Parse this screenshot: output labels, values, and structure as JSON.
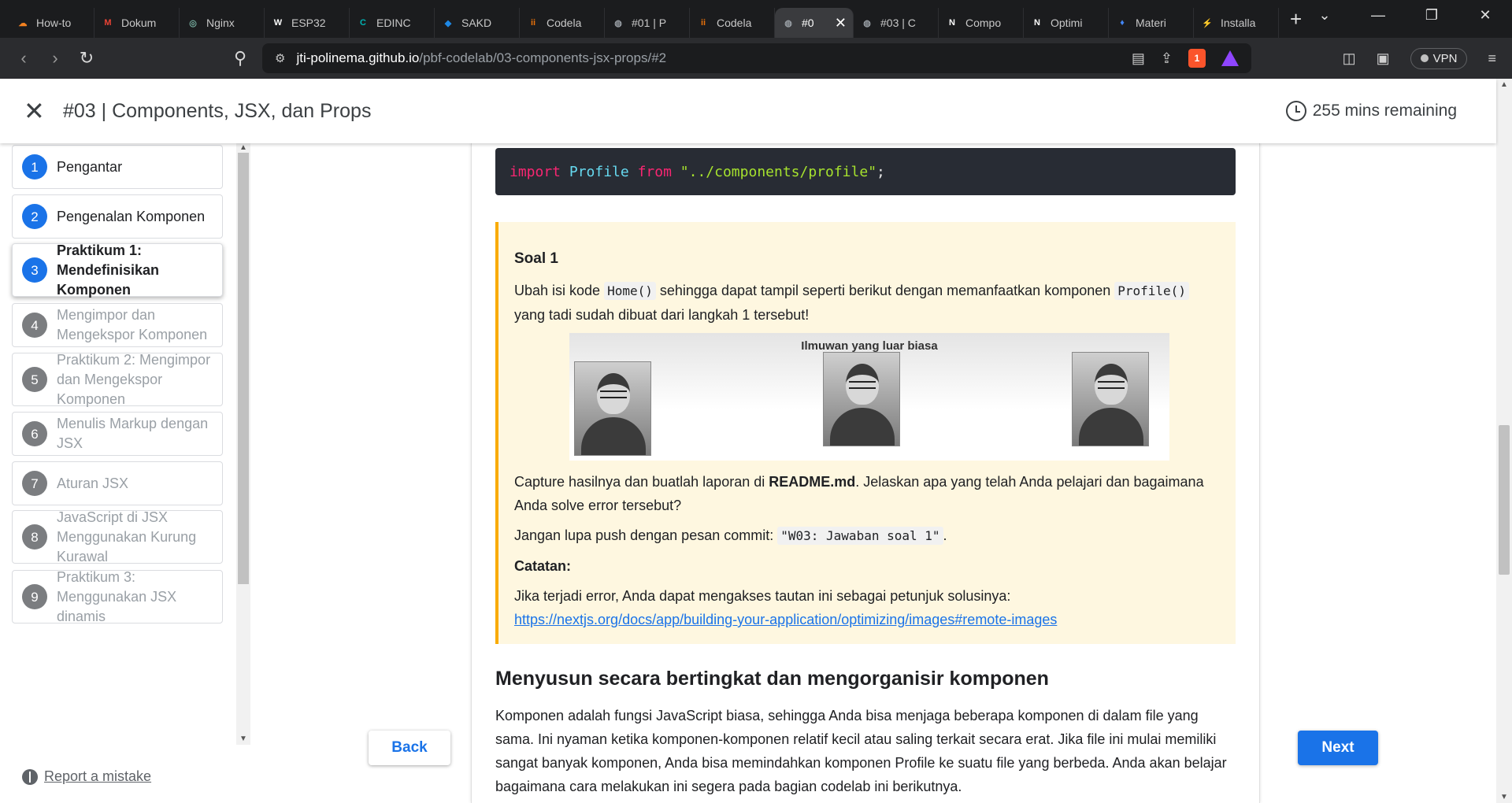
{
  "browser": {
    "tabs": [
      {
        "label": "How-to",
        "icon": "cloud-icon",
        "color": "#f48120",
        "glyph": "☁"
      },
      {
        "label": "Dokum",
        "icon": "gmail-icon",
        "color": "#ea4335",
        "glyph": "M"
      },
      {
        "label": "Nginx",
        "icon": "chatgpt-icon",
        "color": "#74aa9c",
        "glyph": "◎"
      },
      {
        "label": "ESP32",
        "icon": "w-icon",
        "color": "#ffffff",
        "glyph": "W"
      },
      {
        "label": "EDINC",
        "icon": "edinco-icon",
        "color": "#00b3b3",
        "glyph": "C"
      },
      {
        "label": "SAKD",
        "icon": "sakd-icon",
        "color": "#1e88e5",
        "glyph": "◆"
      },
      {
        "label": "Codela",
        "icon": "codelab-icon",
        "color": "#e8710a",
        "glyph": "ii"
      },
      {
        "label": "#01 | P",
        "icon": "globe-icon",
        "color": "#9aa0a6",
        "glyph": "◍"
      },
      {
        "label": "Codela",
        "icon": "codelab-icon",
        "color": "#e8710a",
        "glyph": "ii"
      },
      {
        "label": "#0",
        "icon": "globe-icon",
        "color": "#9aa0a6",
        "glyph": "◍",
        "active": true
      },
      {
        "label": "#03 | C",
        "icon": "globe-icon",
        "color": "#9aa0a6",
        "glyph": "◍"
      },
      {
        "label": "Compo",
        "icon": "notion-icon",
        "color": "#ffffff",
        "glyph": "N"
      },
      {
        "label": "Optimi",
        "icon": "notion-icon",
        "color": "#ffffff",
        "glyph": "N"
      },
      {
        "label": "Materi",
        "icon": "materi-icon",
        "color": "#4285f4",
        "glyph": "♦"
      },
      {
        "label": "Installa",
        "icon": "installa-icon",
        "color": "#26c6da",
        "glyph": "⚡"
      }
    ],
    "url_host": "jti-polinema.github.io",
    "url_path": "/pbf-codelab/03-components-jsx-props/#2",
    "brave_badge": "1",
    "vpn_label": "VPN"
  },
  "header": {
    "title": "#03 | Components, JSX, dan Props",
    "time_remaining": "255 mins remaining"
  },
  "sidebar": {
    "steps": [
      {
        "num": "1",
        "label": "Pengantar",
        "state": "done"
      },
      {
        "num": "2",
        "label": "Pengenalan Komponen",
        "state": "done"
      },
      {
        "num": "3",
        "label": "Praktikum 1: Mendefinisikan Komponen",
        "state": "active"
      },
      {
        "num": "4",
        "label": "Mengimpor dan Mengekspor Komponen",
        "state": "todo"
      },
      {
        "num": "5",
        "label": "Praktikum 2: Mengimpor dan Mengekspor Komponen",
        "state": "todo"
      },
      {
        "num": "6",
        "label": "Menulis Markup dengan JSX",
        "state": "todo"
      },
      {
        "num": "7",
        "label": "Aturan JSX",
        "state": "todo"
      },
      {
        "num": "8",
        "label": "JavaScript di JSX Menggunakan Kurung Kurawal",
        "state": "todo"
      },
      {
        "num": "9",
        "label": "Praktikum 3: Menggunakan JSX dinamis",
        "state": "todo"
      }
    ],
    "report_label": "Report a mistake"
  },
  "code": {
    "kw_import": "import",
    "cls": "Profile",
    "kw_from": "from",
    "str": "\"../components/profile\"",
    "end": ";"
  },
  "note": {
    "title": "Soal 1",
    "p1_a": "Ubah isi kode ",
    "p1_code1": "Home()",
    "p1_b": " sehingga dapat tampil seperti berikut dengan memanfaatkan komponen ",
    "p1_code2": "Profile()",
    "p1_c": " yang tadi sudah dibuat dari langkah 1 tersebut!",
    "image_title": "Ilmuwan yang luar biasa",
    "p2_a": "Capture hasilnya dan buatlah laporan di ",
    "p2_bold": "README.md",
    "p2_b": ". Jelaskan apa yang telah Anda pelajari dan bagaimana Anda solve error tersebut?",
    "p3_a": "Jangan lupa push dengan pesan commit: ",
    "p3_code": "\"W03: Jawaban soal 1\"",
    "p3_b": ".",
    "catatan": "Catatan:",
    "p4": "Jika terjadi error, Anda dapat mengakses tautan ini sebagai petunjuk solusinya:",
    "link": "https://nextjs.org/docs/app/building-your-application/optimizing/images#remote-images"
  },
  "section": {
    "heading": "Menyusun secara bertingkat dan mengorganisir komponen",
    "text": "Komponen adalah fungsi JavaScript biasa, sehingga Anda bisa menjaga beberapa komponen di dalam file yang sama. Ini nyaman ketika komponen-komponen relatif kecil atau saling terkait secara erat. Jika file ini mulai memiliki sangat banyak komponen, Anda bisa memindahkan komponen Profile ke suatu file yang berbeda. Anda akan belajar bagaimana cara melakukan ini segera pada bagian codelab ini berikutnya."
  },
  "nav": {
    "back_label": "Back",
    "next_label": "Next"
  }
}
